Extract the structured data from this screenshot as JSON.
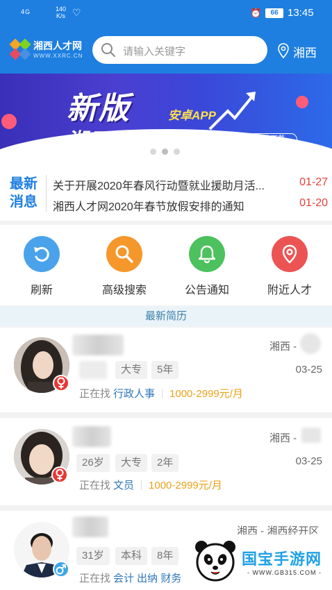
{
  "status_bar": {
    "signal": "4G",
    "net_speed": "140\nK/s",
    "battery": "66",
    "time": "13:45"
  },
  "header": {
    "logo_name": "湘西人才网",
    "logo_url": "WWW.XXRC.CN",
    "search_placeholder": "请输入关键字",
    "location": "湘西"
  },
  "banner": {
    "headline": "新版",
    "subline": "湘西人才网",
    "tag": "安卓APP",
    "download_button": "点击下载",
    "slide_count": 3,
    "active_slide": 1
  },
  "news": {
    "label": "最新消息",
    "items": [
      {
        "title": "关于开展2020年春风行动暨就业援助月活...",
        "date": "01-27"
      },
      {
        "title": "湘西人才网2020年春节放假安排的通知",
        "date": "01-20"
      }
    ]
  },
  "quick_actions": [
    {
      "label": "刷新",
      "icon": "refresh-icon",
      "color": "#4aa3ea"
    },
    {
      "label": "高级搜索",
      "icon": "search-icon",
      "color": "#f5972b"
    },
    {
      "label": "公告通知",
      "icon": "bell-icon",
      "color": "#4cc15e"
    },
    {
      "label": "附近人才",
      "icon": "location-pin-icon",
      "color": "#ec5454"
    }
  ],
  "section_title": "最新简历",
  "resumes": [
    {
      "location": "湘西 -",
      "age": "",
      "education": "大专",
      "experience": "5年",
      "date": "03-25",
      "status_label": "正在找",
      "job": "行政人事",
      "salary": "1000-2999元/月",
      "gender": "female"
    },
    {
      "location": "湘西 -",
      "age": "26岁",
      "education": "大专",
      "experience": "2年",
      "date": "03-25",
      "status_label": "正在找",
      "job": "文员",
      "salary": "1000-2999元/月",
      "gender": "female"
    },
    {
      "location": "湘西 - 湘西经开区",
      "age": "31岁",
      "education": "本科",
      "experience": "8年",
      "date": "",
      "status_label": "正在找",
      "job": "会计 出纳 财务",
      "salary": "",
      "gender": "male"
    }
  ],
  "watermark": {
    "title": "国宝手游网",
    "url": "- WWW.GB315.COM -"
  },
  "colors": {
    "primary": "#1e7fe0",
    "female": "#e53935",
    "male": "#3fa7e6",
    "salary": "#e8a21a",
    "date_red": "#e0413a"
  }
}
